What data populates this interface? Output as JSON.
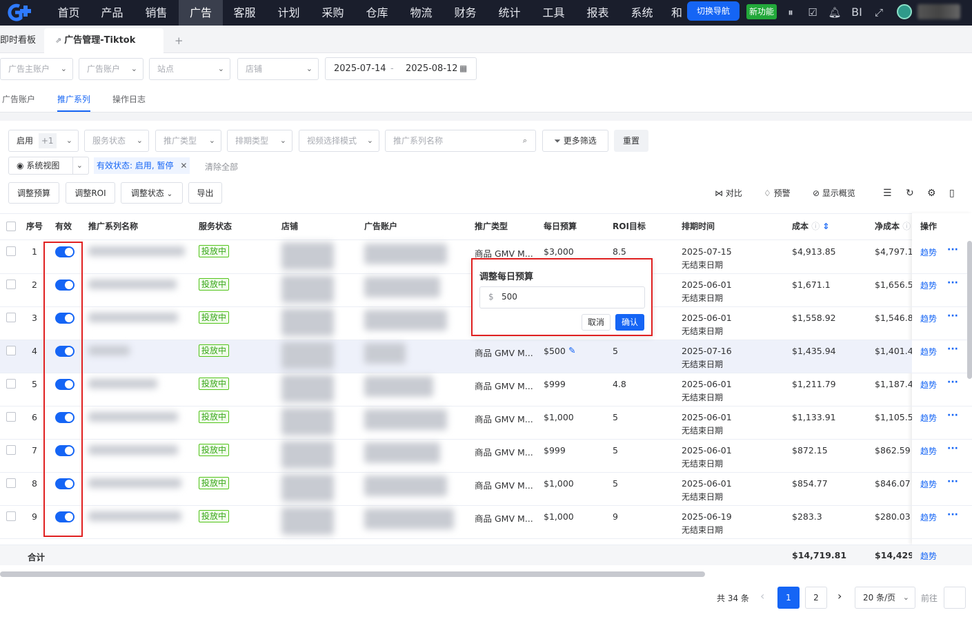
{
  "topnav": {
    "items": [
      "首页",
      "产品",
      "销售",
      "广告",
      "客服",
      "计划",
      "采购",
      "仓库",
      "物流",
      "财务",
      "统计",
      "工具",
      "报表",
      "系统"
    ],
    "active": "广告",
    "overflow_char": "和",
    "switch_nav": "切换导航",
    "new_feature": "新功能",
    "bi": "BI"
  },
  "tabs": {
    "t0": "即时看板",
    "t1": "广告管理-Tiktok",
    "add": "+"
  },
  "filters": {
    "f1": "广告主账户",
    "f2": "广告账户",
    "f3": "站点",
    "f4": "店铺",
    "date_from": "2025-07-14",
    "date_sep": "-",
    "date_to": "2025-08-12"
  },
  "subtabs": {
    "s1": "广告账户",
    "s2": "推广系列",
    "s3": "操作日志"
  },
  "filters2": {
    "enable": "启用",
    "enable_extra": "+1",
    "service": "服务状态",
    "promo_type": "推广类型",
    "schedule_type": "排期类型",
    "video_mode": "视频选择模式",
    "search_placeholder": "推广系列名称",
    "more_filter": "更多筛选",
    "reset": "重置"
  },
  "view": {
    "label": "系统视图",
    "chip": "有效状态: 启用, 暂停",
    "clear": "清除全部"
  },
  "actions": {
    "budget": "调整预算",
    "roi": "调整ROI",
    "status": "调整状态",
    "export": "导出"
  },
  "tools": {
    "compare": "对比",
    "alert": "预警",
    "overview": "显示概览"
  },
  "headers": {
    "idx": "序号",
    "valid": "有效",
    "name": "推广系列名称",
    "service": "服务状态",
    "store": "店铺",
    "account": "广告账户",
    "type": "推广类型",
    "budget": "每日预算",
    "roi": "ROI目标",
    "schedule": "排期时间",
    "cost": "成本",
    "net": "净成本",
    "op": "操作"
  },
  "rows": [
    {
      "idx": "1",
      "status": "投放中",
      "type": "商品 GMV M...",
      "budget": "$3,000",
      "roi": "8.5",
      "date": "2025-07-15",
      "end": "无结束日期",
      "cost": "$4,913.85",
      "net": "$4,797.1",
      "trend": "趋势"
    },
    {
      "idx": "2",
      "status": "投放中",
      "type": "",
      "budget": "",
      "roi": "",
      "date": "2025-06-01",
      "end": "无结束日期",
      "cost": "$1,671.1",
      "net": "$1,656.5",
      "trend": "趋势"
    },
    {
      "idx": "3",
      "status": "投放中",
      "type": "",
      "budget": "",
      "roi": "",
      "date": "2025-06-01",
      "end": "无结束日期",
      "cost": "$1,558.92",
      "net": "$1,546.8",
      "trend": "趋势"
    },
    {
      "idx": "4",
      "status": "投放中",
      "type": "商品 GMV M...",
      "budget": "$500",
      "roi": "5",
      "date": "2025-07-16",
      "end": "无结束日期",
      "cost": "$1,435.94",
      "net": "$1,401.4",
      "trend": "趋势"
    },
    {
      "idx": "5",
      "status": "投放中",
      "type": "商品 GMV M...",
      "budget": "$999",
      "roi": "4.8",
      "date": "2025-06-01",
      "end": "无结束日期",
      "cost": "$1,211.79",
      "net": "$1,187.4",
      "trend": "趋势"
    },
    {
      "idx": "6",
      "status": "投放中",
      "type": "商品 GMV M...",
      "budget": "$1,000",
      "roi": "5",
      "date": "2025-06-01",
      "end": "无结束日期",
      "cost": "$1,133.91",
      "net": "$1,105.5",
      "trend": "趋势"
    },
    {
      "idx": "7",
      "status": "投放中",
      "type": "商品 GMV M...",
      "budget": "$999",
      "roi": "5",
      "date": "2025-06-01",
      "end": "无结束日期",
      "cost": "$872.15",
      "net": "$862.59",
      "trend": "趋势"
    },
    {
      "idx": "8",
      "status": "投放中",
      "type": "商品 GMV M...",
      "budget": "$1,000",
      "roi": "5",
      "date": "2025-06-01",
      "end": "无结束日期",
      "cost": "$854.77",
      "net": "$846.07",
      "trend": "趋势"
    },
    {
      "idx": "9",
      "status": "投放中",
      "type": "商品 GMV M...",
      "budget": "$1,000",
      "roi": "9",
      "date": "2025-06-19",
      "end": "无结束日期",
      "cost": "$283.3",
      "net": "$280.03",
      "trend": "趋势"
    }
  ],
  "total": {
    "label": "合计",
    "cost": "$14,719.81",
    "net": "$14,429",
    "trend": "趋势"
  },
  "popup": {
    "title": "调整每日预算",
    "currency": "$",
    "value": "500",
    "cancel": "取消",
    "confirm": "确认"
  },
  "pager": {
    "total": "共 34 条",
    "prev": "‹",
    "p1": "1",
    "p2": "2",
    "next": "›",
    "size": "20 条/页",
    "goto": "前往"
  },
  "colors": {
    "accent": "#1565f5",
    "nav_bg": "#1a1e2c",
    "highlight": "#e02020",
    "status_green": "#3aa81c"
  }
}
